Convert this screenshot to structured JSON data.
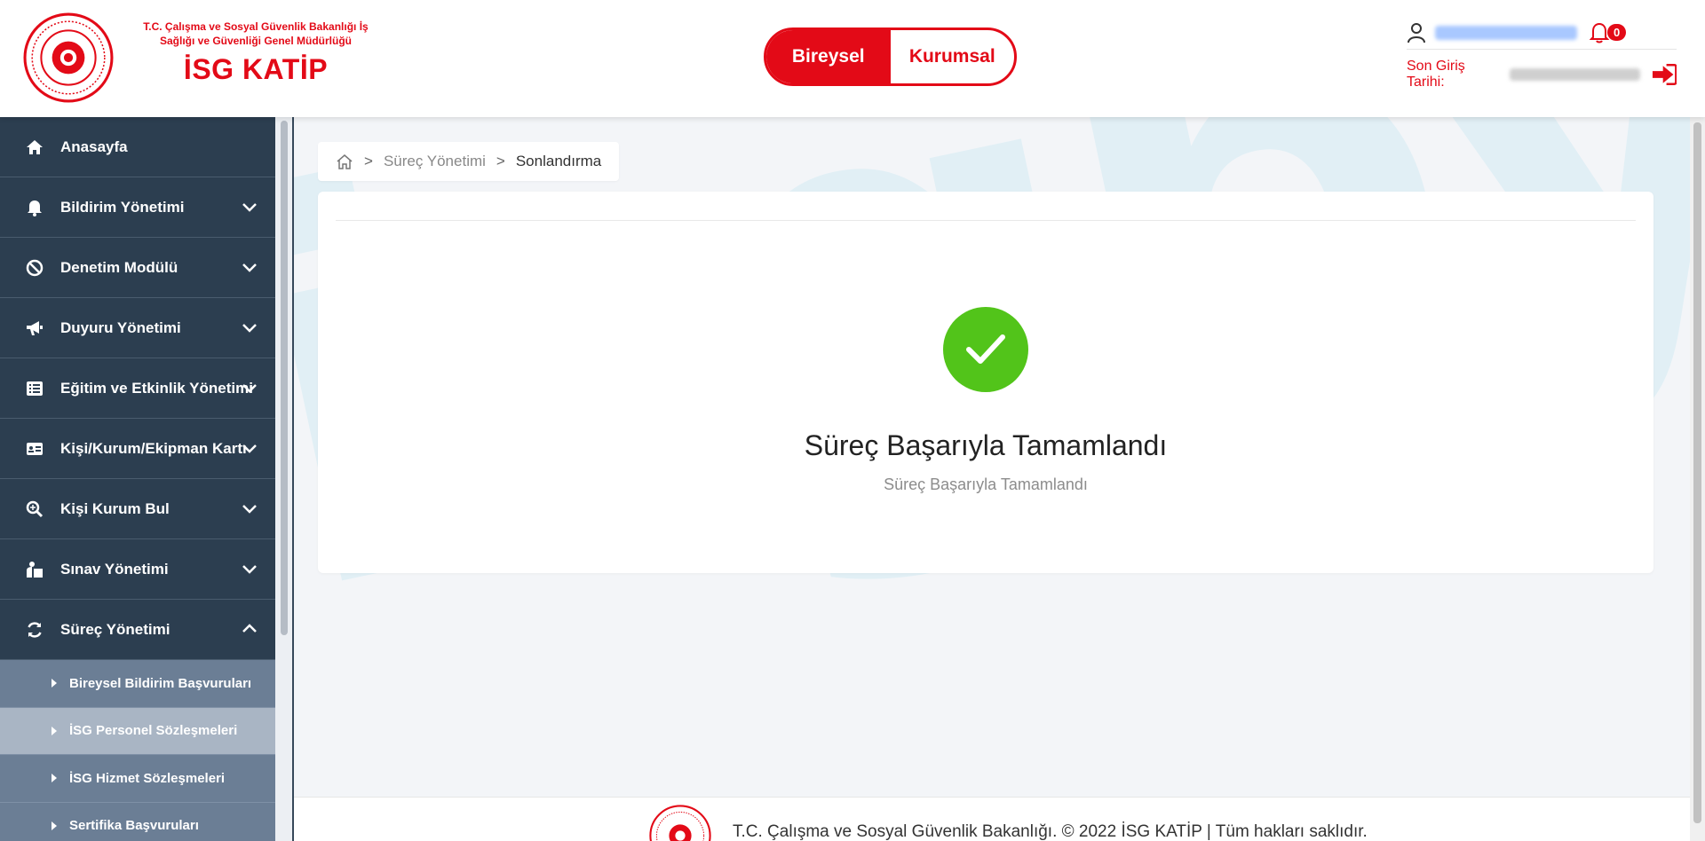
{
  "header": {
    "ministry_line": "T.C. Çalışma ve Sosyal Güvenlik Bakanlığı İş Sağlığı ve Güvenliği Genel Müdürlüğü",
    "app_title": "İSG KATİP",
    "toggle": {
      "bireysel": "Bireysel",
      "kurumsal": "Kurumsal"
    },
    "notification_count": "0",
    "last_login_label": "Son Giriş Tarihi:"
  },
  "sidebar": {
    "items": [
      {
        "label": "Anasayfa",
        "icon": "home-icon"
      },
      {
        "label": "Bildirim Yönetimi",
        "icon": "bell-icon"
      },
      {
        "label": "Denetim Modülü",
        "icon": "ban-icon"
      },
      {
        "label": "Duyuru Yönetimi",
        "icon": "megaphone-icon"
      },
      {
        "label": "Eğitim ve Etkinlik Yönetimi",
        "icon": "list-icon"
      },
      {
        "label": "Kişi/Kurum/Ekipman Kartı",
        "icon": "id-card-icon"
      },
      {
        "label": "Kişi Kurum Bul",
        "icon": "search-icon"
      },
      {
        "label": "Sınav Yönetimi",
        "icon": "exam-icon"
      },
      {
        "label": "Süreç Yönetimi",
        "icon": "sync-icon"
      }
    ],
    "sub_items": [
      {
        "label": "Bireysel Bildirim Başvuruları"
      },
      {
        "label": "İSG Personel Sözleşmeleri"
      },
      {
        "label": "İSG Hizmet Sözleşmeleri"
      },
      {
        "label": "Sertifika Başvuruları"
      }
    ]
  },
  "breadcrumb": {
    "level1": "Süreç Yönetimi",
    "level2": "Sonlandırma"
  },
  "result": {
    "title": "Süreç Başarıyla Tamamlandı",
    "subtitle": "Süreç Başarıyla Tamamlandı"
  },
  "watermark": "isgbys",
  "footer": {
    "text": "T.C. Çalışma ve Sosyal Güvenlik Bakanlığı. © 2022 İSG KATİP | Tüm hakları saklıdır."
  },
  "colors": {
    "brand_red": "#e30a17",
    "sidebar_bg": "#2c3e50",
    "success_green": "#52c41a"
  }
}
